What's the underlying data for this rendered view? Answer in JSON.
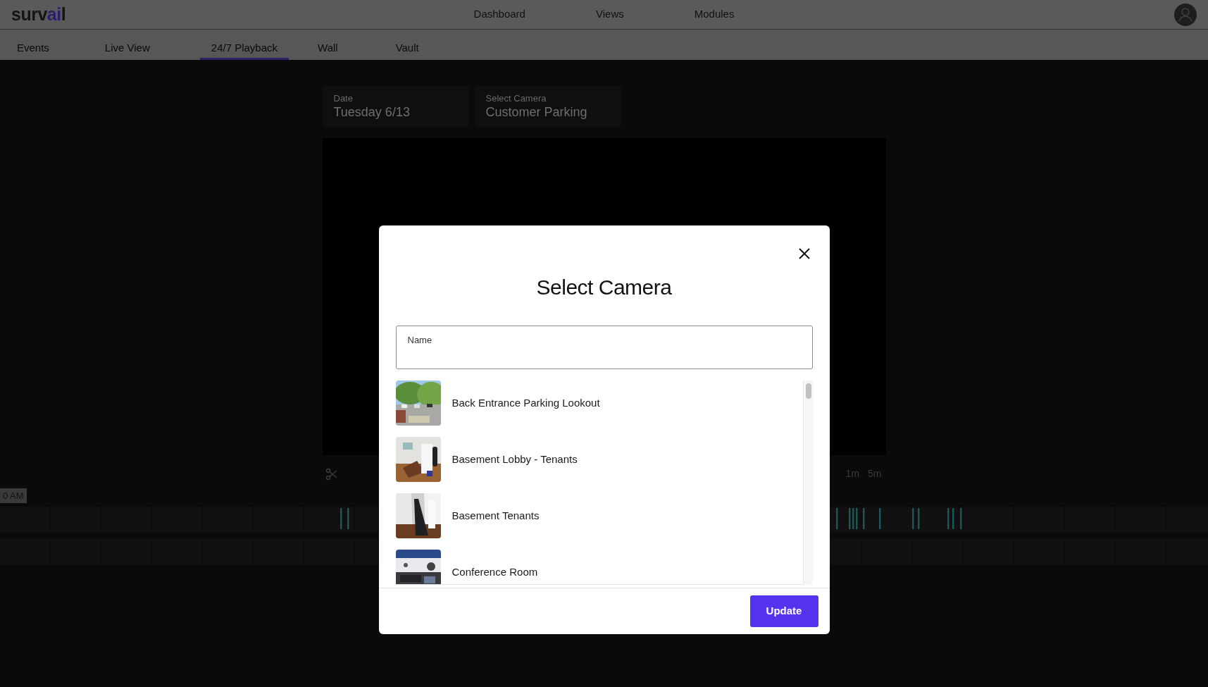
{
  "header": {
    "logo": [
      {
        "text": "surv",
        "accent": false
      },
      {
        "text": "ai",
        "accent": true
      },
      {
        "text": "l",
        "accent": false
      }
    ],
    "nav": [
      "Dashboard",
      "Views",
      "Modules"
    ]
  },
  "tabs": [
    {
      "label": "Events",
      "selected": false
    },
    {
      "label": "Live View",
      "selected": false
    },
    {
      "label": "24/7 Playback",
      "selected": true
    },
    {
      "label": "Wall",
      "selected": false
    },
    {
      "label": "Vault",
      "selected": false
    }
  ],
  "filters": [
    {
      "label": "Date",
      "value": "Tuesday 6/13"
    },
    {
      "label": "Select Camera",
      "value": "Customer Parking"
    }
  ],
  "player": {
    "zoom_options": [
      "1m",
      "5m"
    ],
    "time_label": "0 AM"
  },
  "modal": {
    "title": "Select Camera",
    "search": {
      "label": "Name"
    },
    "cameras": [
      {
        "name": "Back Entrance Parking Lookout"
      },
      {
        "name": "Basement Lobby - Tenants"
      },
      {
        "name": "Basement Tenants"
      },
      {
        "name": "Conference Room"
      }
    ],
    "button": "Update"
  }
}
